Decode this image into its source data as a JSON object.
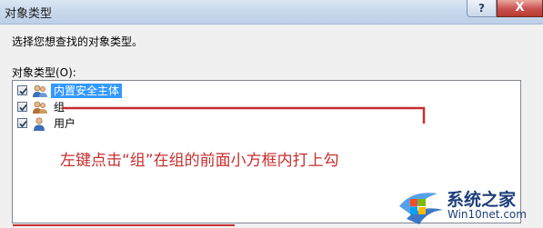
{
  "window": {
    "title": "对象类型",
    "help_label": "?",
    "close_label": "X"
  },
  "dialog": {
    "prompt": "选择您想查找的对象类型。",
    "types_label": "对象类型(O):",
    "items": [
      {
        "label": "内置安全主体",
        "checked": true,
        "selected": true,
        "icon": "security-principal-icon"
      },
      {
        "label": "组",
        "checked": true,
        "selected": false,
        "icon": "group-icon"
      },
      {
        "label": "用户",
        "checked": true,
        "selected": false,
        "icon": "user-icon"
      }
    ]
  },
  "annotation": {
    "text": "左键点击“组”在组的前面小方框内打上勾",
    "color": "#c62e2e"
  },
  "watermark": {
    "title": "系统之家",
    "url": "Win10net.com"
  },
  "colors": {
    "selection": "#3399ff",
    "annotation_red": "#c62e2e",
    "watermark_blue": "#1b3d7a"
  }
}
